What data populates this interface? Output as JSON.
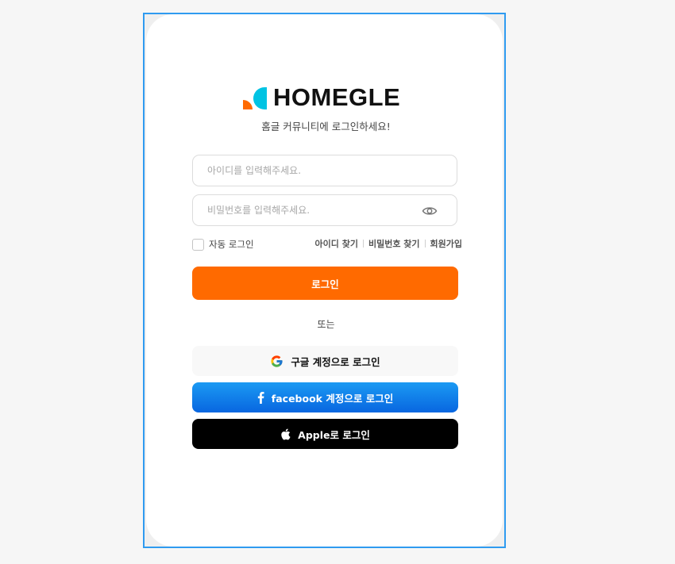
{
  "brand": {
    "name": "HOMEGLE"
  },
  "login": {
    "subtitle": "홈글 커뮤니티에 로그인하세요!",
    "id_placeholder": "아이디를 입력해주세요.",
    "password_placeholder": "비밀번호를 입력해주세요.",
    "remember_label": "자동 로그인",
    "find_id": "아이디 찾기",
    "find_password": "비밀번호 찾기",
    "signup": "회원가입",
    "login_button": "로그인",
    "or_text": "또는",
    "google_button": "구글 계정으로 로그인",
    "facebook_button": "facebook 계정으로 로그인",
    "apple_button": "Apple로 로그인"
  },
  "colors": {
    "accent": "#ff6a00",
    "facebook": "#1877f2",
    "apple": "#000000",
    "logo_orange": "#ff6a00",
    "logo_cyan": "#00c3e3"
  },
  "icons": {
    "password_toggle": "eye-icon",
    "google": "google-g-icon",
    "facebook": "facebook-f-icon",
    "apple": "apple-icon"
  }
}
